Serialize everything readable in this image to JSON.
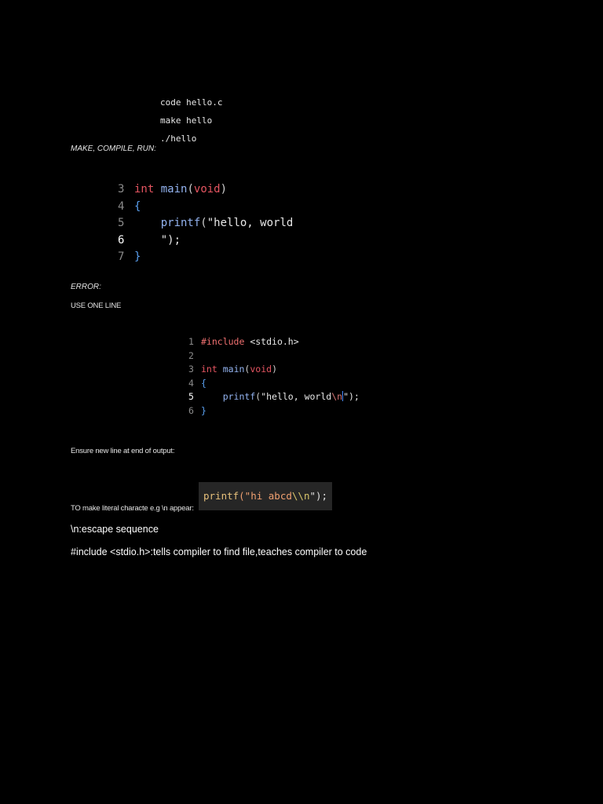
{
  "commands": [
    "code hello.c",
    "make hello",
    "./hello"
  ],
  "labels": {
    "make_compile_run": "MAKE, COMPILE, RUN:",
    "error": "ERROR:",
    "use_one_line": "USE ONE LINE",
    "ensure_newline": "Ensure new line at end of output:",
    "literal_char": "TO make literal characte e.g \\n appear:",
    "escape_sequence": "\\n:escape sequence",
    "include_note": "#include <stdio.h>:tells compiler to find file,teaches compiler to code"
  },
  "code_error": {
    "line_numbers": [
      "3",
      "4",
      "5",
      "6",
      "7"
    ],
    "int_kw": "int",
    "main_fn": "main",
    "void_kw": "void",
    "open_brace": "{",
    "printf_fn": "printf",
    "string_part1": "\"hello, world",
    "string_part2": "\");",
    "close_brace": "}"
  },
  "code_fixed": {
    "line_numbers": [
      "1",
      "2",
      "3",
      "4",
      "5",
      "6"
    ],
    "include_kw": "#include",
    "header": "<stdio.h>",
    "int_kw": "int",
    "main_fn": "main",
    "void_kw": "void",
    "open_brace": "{",
    "printf_fn": "printf",
    "string_text": "\"hello, world",
    "escape": "\\n",
    "string_end": "\");",
    "close_brace": "}"
  },
  "snippet": {
    "fn": "printf",
    "str_start": "(\"hi abcd",
    "escape": "\\\\n",
    "str_end": "\");"
  },
  "colors": {
    "background": "#000000",
    "keyword": "#e55561",
    "function": "#93b3f0",
    "brace": "#5aa0f0",
    "snippet_bg": "#262626"
  }
}
